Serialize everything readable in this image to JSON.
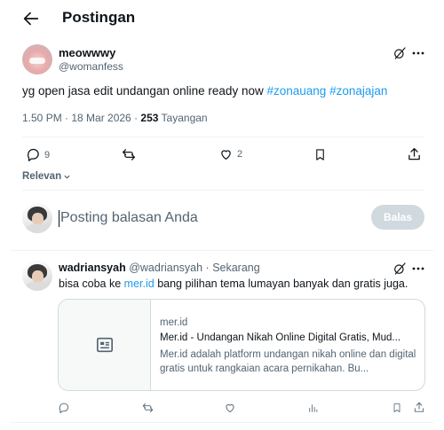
{
  "header": {
    "back_icon": "arrow-left-icon",
    "title": "Postingan"
  },
  "post": {
    "display_name": "meowwwy",
    "handle": "@womanfess",
    "text_plain": "yg open jasa edit undangan online ready now ",
    "hashtags": [
      "#zonauang",
      "#zonajajan"
    ],
    "time": "1.50 PM · 18 Mar 2026 · ",
    "views_count": "253",
    "views_label": " Tayangan",
    "actions": {
      "replies": "9",
      "likes": "2"
    },
    "sort_label": "Relevan"
  },
  "reply_box": {
    "placeholder": "Posting balasan Anda",
    "button_label": "Balas"
  },
  "reply": {
    "display_name": "wadriansyah",
    "handle_time": "@wadriansyah · Sekarang",
    "text_before": "bisa coba ke ",
    "link": "mer.id",
    "text_after": " bang pilihan tema lumayan banyak dan gratis juga.",
    "card": {
      "domain": "mer.id",
      "title": "Mer.id - Undangan Nikah Online Digital Gratis, Mud...",
      "description": "Mer.id adalah platform undangan nikah online dan digital gratis untuk rangkaian acara pernikahan. Bu..."
    }
  },
  "colors": {
    "accent": "#1d9bf0",
    "muted": "#536471",
    "button_disabled": "#cfd9de"
  }
}
